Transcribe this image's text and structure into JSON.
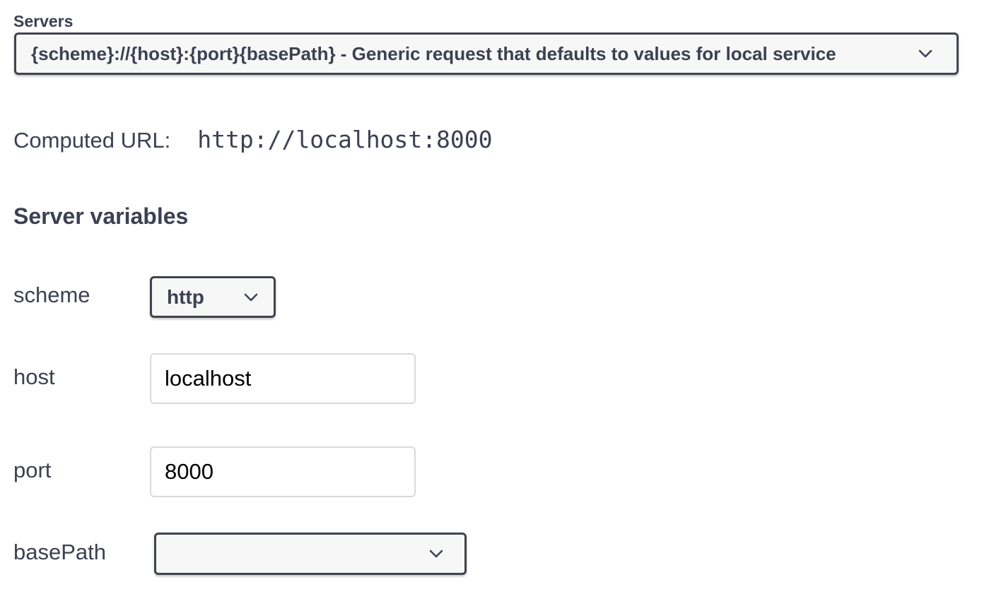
{
  "servers": {
    "label": "Servers",
    "selected": "{scheme}://{host}:{port}{basePath} - Generic request that defaults to values for local service"
  },
  "computed": {
    "label": "Computed URL:",
    "url": "http://localhost:8000"
  },
  "server_variables": {
    "title": "Server variables",
    "scheme": {
      "label": "scheme",
      "value": "http"
    },
    "host": {
      "label": "host",
      "value": "localhost"
    },
    "port": {
      "label": "port",
      "value": "8000"
    },
    "basePath": {
      "label": "basePath",
      "value": ""
    }
  },
  "icons": {
    "dropdown": "chevron-down-icon"
  }
}
